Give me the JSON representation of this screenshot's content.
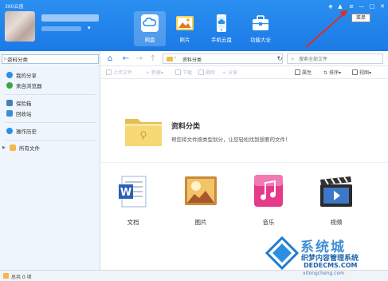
{
  "app": {
    "title": "360云盘"
  },
  "user": {
    "dropdown_glyph": "▾"
  },
  "nav_tabs": [
    {
      "label": "网盘",
      "icon": "cloud-drive-icon"
    },
    {
      "label": "照片",
      "icon": "photo-icon"
    },
    {
      "label": "手机云盘",
      "icon": "phone-cloud-icon"
    },
    {
      "label": "功能大全",
      "icon": "toolbox-icon"
    }
  ],
  "window_controls": {
    "skin": "◈",
    "hat": "▲",
    "menu": "≡",
    "minimize": "—",
    "maximize": "□",
    "close": "✕"
  },
  "tooltip": {
    "text": "菜单"
  },
  "sidebar": {
    "items": [
      {
        "label": "资料分类",
        "icon": "category-icon",
        "color": "#4a90d9"
      },
      {
        "label": "我的分享",
        "icon": "share-icon",
        "color": "#2a8fe8"
      },
      {
        "label": "来自浏览器",
        "icon": "browser-icon",
        "color": "#38a83a"
      },
      {
        "label": "保险箱",
        "icon": "safe-icon",
        "color": "#4a7fb8"
      },
      {
        "label": "回收站",
        "icon": "recycle-bin-icon",
        "color": "#3a8fd0"
      },
      {
        "label": "操作历史",
        "icon": "history-icon",
        "color": "#2a8fe8"
      },
      {
        "label": "所有文件",
        "icon": "folder-icon",
        "color": "#f2b94a"
      }
    ],
    "caret_collapsed": "▶",
    "caret_selected": "▷"
  },
  "addressbar": {
    "home": "⌂",
    "back": "←",
    "forward": "→",
    "up": "↑",
    "path_arrow": "›",
    "path": "资料分类",
    "path_dropdown": "▾",
    "refresh": "↻",
    "search_placeholder": "搜索全部文件",
    "search_glyph": "⌕"
  },
  "actions": {
    "upload": "上传文件",
    "new": "新建",
    "download": "下载",
    "delete": "删除",
    "share": "分享",
    "dropdown": "▾",
    "properties": "属性",
    "sort": "排序",
    "view": "视图"
  },
  "category": {
    "title": "资料分类",
    "description": "帮您将文件按类型划分，让您轻松找到想要的文件！"
  },
  "file_types": [
    {
      "label": "文档",
      "icon": "document-icon"
    },
    {
      "label": "图片",
      "icon": "picture-icon"
    },
    {
      "label": "音乐",
      "icon": "music-icon"
    },
    {
      "label": "视频",
      "icon": "video-icon"
    }
  ],
  "status": {
    "text": "总共 0 项"
  },
  "watermark": {
    "big": "系统城",
    "sub": "织梦内容管理系统",
    "url": "DEDECMS.COM",
    "url2": "xitongcheng.com"
  },
  "colors": {
    "accent": "#1c7ae6",
    "annotation_arrow": "#d9302c"
  }
}
